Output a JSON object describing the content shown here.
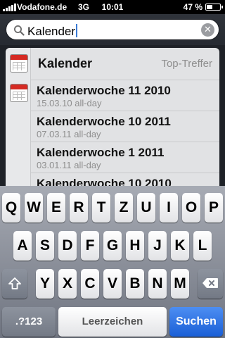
{
  "status_bar": {
    "carrier": "Vodafone.de",
    "network": "3G",
    "time": "10:01",
    "battery_percent": "47 %",
    "battery_level": 0.47
  },
  "search": {
    "query": "Kalender"
  },
  "results": {
    "top_hit": {
      "title": "Kalender",
      "tag": "Top-Treffer"
    },
    "items": [
      {
        "title": "Kalenderwoche 11 2010",
        "subtitle": "15.03.10 all-day"
      },
      {
        "title": "Kalenderwoche 10 2011",
        "subtitle": "07.03.11 all-day"
      },
      {
        "title": "Kalenderwoche 1 2011",
        "subtitle": "03.01.11 all-day"
      },
      {
        "title": "Kalenderwoche 10 2010",
        "subtitle": ""
      }
    ]
  },
  "keyboard": {
    "row1": [
      "Q",
      "W",
      "E",
      "R",
      "T",
      "Z",
      "U",
      "I",
      "O",
      "P"
    ],
    "row2": [
      "A",
      "S",
      "D",
      "F",
      "G",
      "H",
      "J",
      "K",
      "L"
    ],
    "row3": [
      "Y",
      "X",
      "C",
      "V",
      "B",
      "N",
      "M"
    ],
    "shift_icon": "shift-arrow-icon",
    "backspace_icon": "backspace-icon",
    "numbers_label": ".?123",
    "space_label": "Leerzeichen",
    "search_label": "Suchen",
    "accent_color": "#1a5fd6"
  }
}
